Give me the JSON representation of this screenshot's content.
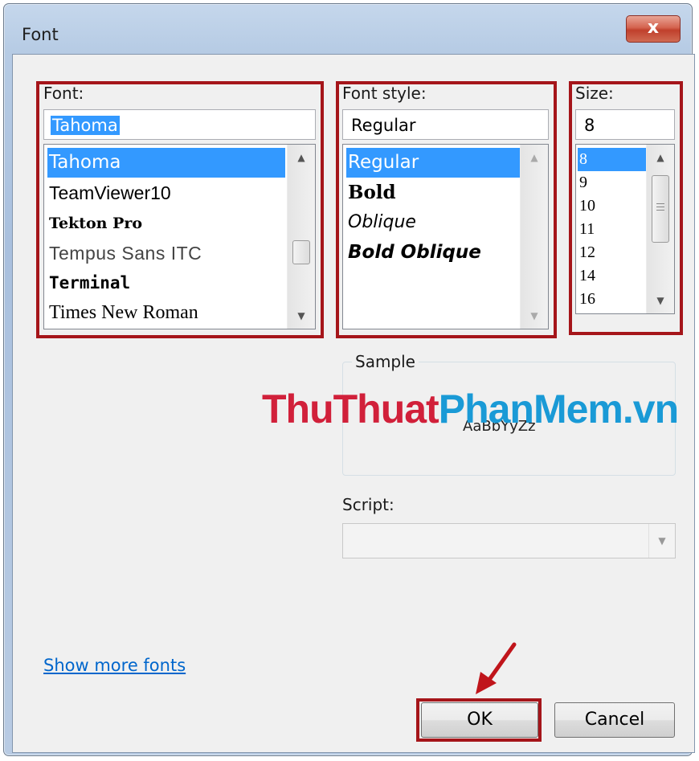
{
  "window": {
    "title": "Font",
    "close_glyph": "x"
  },
  "font": {
    "label": "Font:",
    "value": "Tahoma",
    "items": [
      "Tahoma",
      "TeamViewer10",
      "Tekton Pro",
      "Tempus Sans ITC",
      "Terminal",
      "Times New Roman"
    ],
    "selected": "Tahoma"
  },
  "style": {
    "label": "Font style:",
    "value": "Regular",
    "items": [
      "Regular",
      "Bold",
      "Oblique",
      "Bold Oblique"
    ],
    "selected": "Regular"
  },
  "size": {
    "label": "Size:",
    "value": "8",
    "items": [
      "8",
      "9",
      "10",
      "11",
      "12",
      "14",
      "16"
    ],
    "selected": "8"
  },
  "sample": {
    "label": "Sample",
    "text": "AaBbYyZz"
  },
  "script": {
    "label": "Script:",
    "value": ""
  },
  "show_more_fonts": "Show more fonts",
  "buttons": {
    "ok": "OK",
    "cancel": "Cancel"
  },
  "watermark": {
    "part1": "ThuThuat",
    "part2": "PhanMem",
    "part3": ".vn"
  },
  "colors": {
    "selection": "#3399ff",
    "highlight_box": "#a5151a",
    "link": "#0066cc",
    "watermark_red": "#d1203a",
    "watermark_blue": "#1a9ad6"
  },
  "icons": [
    "close-icon",
    "scroll-up-arrow-icon",
    "scroll-down-arrow-icon",
    "dropdown-arrow-icon",
    "red-arrow-icon"
  ]
}
